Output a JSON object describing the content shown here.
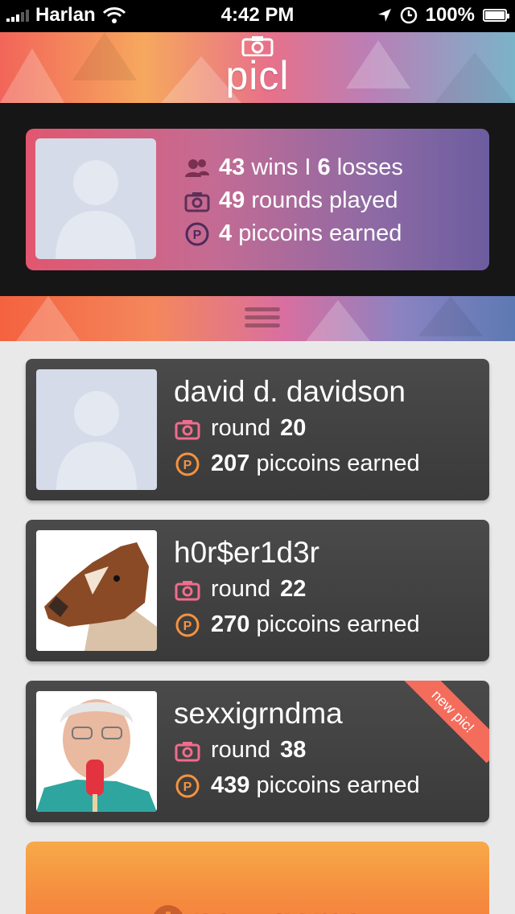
{
  "status": {
    "carrier": "Harlan",
    "time": "4:42 PM",
    "battery": "100%"
  },
  "header": {
    "app_name": "picl"
  },
  "profile": {
    "wins": "43",
    "wins_label": "wins",
    "separator": "I",
    "losses": "6",
    "losses_label": "losses",
    "rounds": "49",
    "rounds_label": "rounds played",
    "piccoins": "4",
    "piccoins_label": "piccoins earned"
  },
  "games": [
    {
      "name": "david d. davidson",
      "round_label": "round",
      "round": "20",
      "piccoins": "207",
      "piccoins_label": "piccoins earned",
      "badge": ""
    },
    {
      "name": "h0r$er1d3r",
      "round_label": "round",
      "round": "22",
      "piccoins": "270",
      "piccoins_label": "piccoins earned",
      "badge": ""
    },
    {
      "name": "sexxigrndma",
      "round_label": "round",
      "round": "38",
      "piccoins": "439",
      "piccoins_label": "piccoins earned",
      "badge": "new pic!"
    }
  ],
  "new_game": {
    "label": "new game"
  },
  "colors": {
    "accent_orange": "#f58b3f",
    "ribbon": "#f46c5b",
    "card_dark": "#404040"
  }
}
